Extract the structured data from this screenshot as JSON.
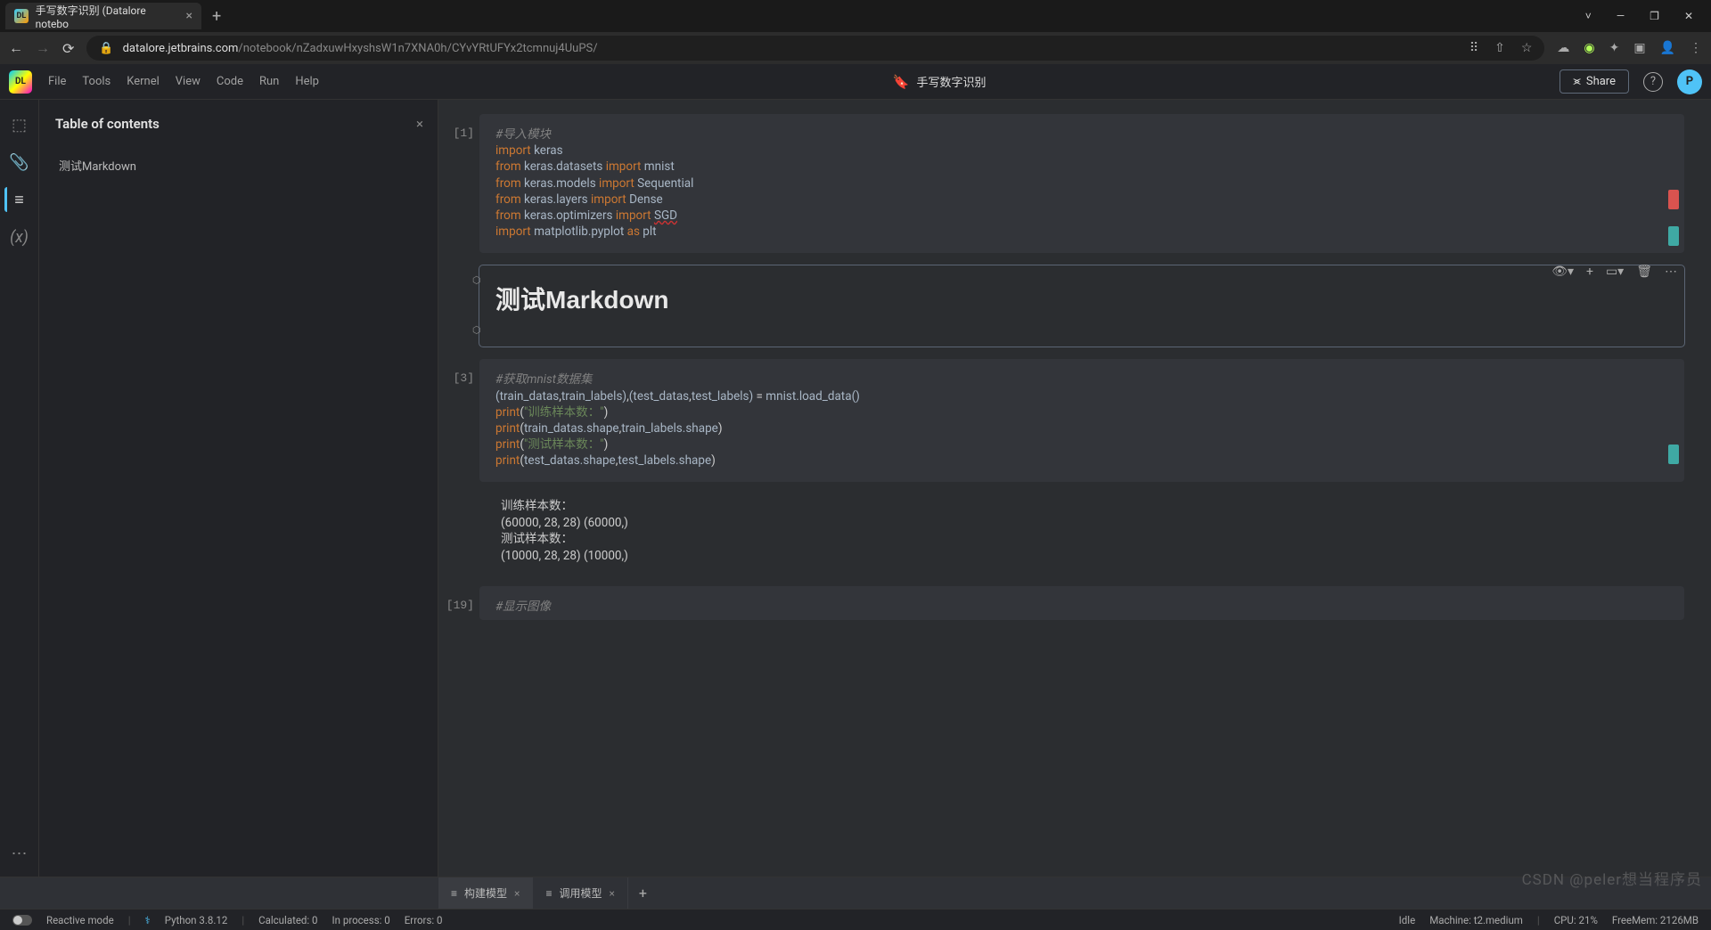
{
  "browser": {
    "tab_title": "手写数字识别 (Datalore notebo",
    "url_host": "datalore.jetbrains.com",
    "url_path": "/notebook/nZadxuwHxyshsW1n7XNA0h/CYvYRtUFYx2tcmnuj4UuPS/"
  },
  "menu": [
    "File",
    "Tools",
    "Kernel",
    "View",
    "Code",
    "Run",
    "Help"
  ],
  "doc_title": "手写数字识别",
  "share_label": "Share",
  "avatar_letter": "P",
  "toc_title": "Table of contents",
  "toc_items": [
    "测试Markdown"
  ],
  "cells": {
    "c1": {
      "num": "[1]",
      "lines": [
        {
          "t": "com",
          "v": "#导入模块"
        },
        {
          "raw": "<span class='kw'>import</span> <span class='id'>keras</span>"
        },
        {
          "raw": "<span class='kw'>from</span> <span class='id'>keras.datasets</span> <span class='kw'>import</span> <span class='id'>mnist</span>"
        },
        {
          "raw": "<span class='kw'>from</span> <span class='id'>keras.models</span> <span class='kw'>import</span> <span class='id'>Sequential</span>"
        },
        {
          "raw": "<span class='kw'>from</span> <span class='id'>keras.layers</span> <span class='kw'>import</span> <span class='id'>Dense</span>"
        },
        {
          "raw": "<span class='kw'>from</span> <span class='id'>keras.optimizers</span> <span class='kw'>import</span> <span class='id err'>SGD</span>"
        },
        {
          "raw": "<span class='kw'>import</span> <span class='id'>matplotlib.pyplot</span> <span class='kw'>as</span> <span class='id'>plt</span>"
        }
      ]
    },
    "md": {
      "title": "测试Markdown"
    },
    "c3": {
      "num": "[3]",
      "lines": [
        {
          "t": "com",
          "v": "#获取mnist数据集"
        },
        {
          "raw": "<span class='id'>(train_datas</span>,<span class='id'>train_labels)</span>,<span class='id'>(test_datas</span>,<span class='id'>test_labels)</span> = <span class='id'>mnist.load_data()</span>"
        },
        {
          "raw": "<span class='kw'>print</span>(<span class='str'>\"训练样本数：\"</span>)"
        },
        {
          "raw": "<span class='kw'>print</span>(<span class='id'>train_datas.shape</span>,<span class='id'>train_labels.shape</span>)"
        },
        {
          "raw": "<span class='kw'>print</span>(<span class='str'>\"测试样本数：\"</span>)"
        },
        {
          "raw": "<span class='kw'>print</span>(<span class='id'>test_datas.shape</span>,<span class='id'>test_labels.shape</span>)"
        }
      ],
      "output": [
        "训练样本数：",
        "(60000, 28, 28) (60000,)",
        "测试样本数：",
        "(10000, 28, 28) (10000,)"
      ]
    },
    "c19": {
      "num": "[19]",
      "lines": [
        {
          "t": "com",
          "v": "#显示图像"
        }
      ]
    }
  },
  "bottom_tabs": [
    {
      "label": "构建模型",
      "active": true
    },
    {
      "label": "调用模型",
      "active": false
    }
  ],
  "status": {
    "reactive": "Reactive mode",
    "python": "Python 3.8.12",
    "calculated": "Calculated: 0",
    "inprocess": "In process: 0",
    "errors": "Errors: 0",
    "idle": "Idle",
    "machine": "Machine: t2.medium",
    "cpu": "CPU: 21%",
    "mem": "FreeMem: 2126MB"
  },
  "watermark": "CSDN @peler想当程序员"
}
